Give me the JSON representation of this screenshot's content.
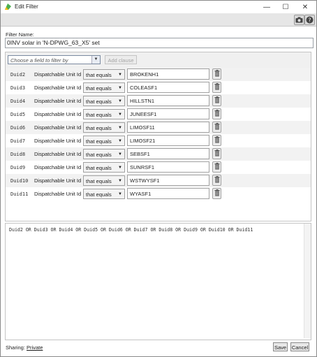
{
  "window": {
    "title": "Edit Filter",
    "minimize_label": "—",
    "maximize_label": "☐",
    "close_label": "✕"
  },
  "toolbar": {
    "camera_icon": "camera-icon",
    "help_icon": "help-icon"
  },
  "filter_name": {
    "label": "Filter Name:",
    "value": "0INV solar in 'N-DPWG_63_X5' set"
  },
  "field_selector": {
    "placeholder": "Choose a field to filter by",
    "add_clause_label": "Add clause"
  },
  "clauses": [
    {
      "var": "Duid2",
      "field": "Dispatchable Unit Id",
      "operator": "that equals",
      "value": "BROKENH1"
    },
    {
      "var": "Duid3",
      "field": "Dispatchable Unit Id",
      "operator": "that equals",
      "value": "COLEASF1"
    },
    {
      "var": "Duid4",
      "field": "Dispatchable Unit Id",
      "operator": "that equals",
      "value": "HILLSTN1"
    },
    {
      "var": "Duid5",
      "field": "Dispatchable Unit Id",
      "operator": "that equals",
      "value": "JUNEESF1"
    },
    {
      "var": "Duid6",
      "field": "Dispatchable Unit Id",
      "operator": "that equals",
      "value": "LIMOSF11"
    },
    {
      "var": "Duid7",
      "field": "Dispatchable Unit Id",
      "operator": "that equals",
      "value": "LIMOSF21"
    },
    {
      "var": "Duid8",
      "field": "Dispatchable Unit Id",
      "operator": "that equals",
      "value": "SEBSF1"
    },
    {
      "var": "Duid9",
      "field": "Dispatchable Unit Id",
      "operator": "that equals",
      "value": "SUNRSF1"
    },
    {
      "var": "Duid10",
      "field": "Dispatchable Unit Id",
      "operator": "that equals",
      "value": "WSTWYSF1"
    },
    {
      "var": "Duid11",
      "field": "Dispatchable Unit Id",
      "operator": "that equals",
      "value": "WYASF1"
    }
  ],
  "expression": "Duid2 OR Duid3 OR Duid4 OR Duid5 OR Duid6 OR Duid7 OR Duid8 OR Duid9 OR Duid10 OR Duid11",
  "footer": {
    "sharing_label": "Sharing:",
    "sharing_value": "Private",
    "save_label": "Save",
    "cancel_label": "Cancel"
  },
  "colors": {
    "toolbar_bg": "#e6e6e6",
    "row_alt_bg": "#f2f2f2",
    "disabled_text": "#a4a4a4"
  }
}
